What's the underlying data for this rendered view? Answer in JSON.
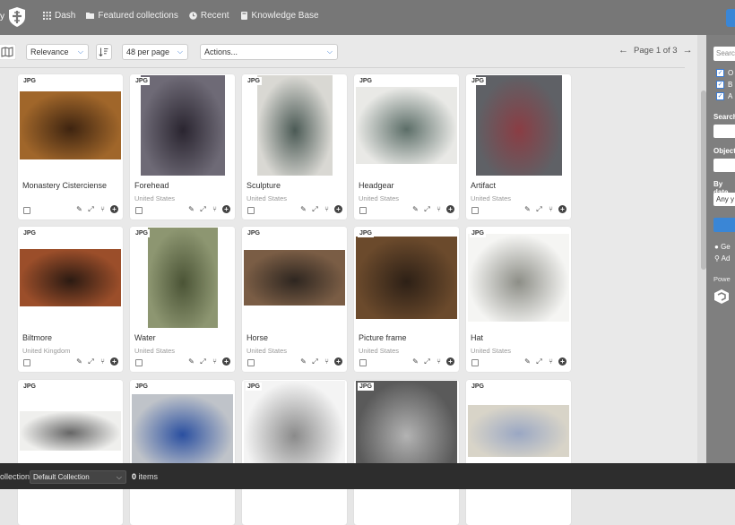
{
  "topbar": {
    "stub_text": "y",
    "nav": [
      {
        "icon": "dashboard-grid-icon",
        "label": "Dash"
      },
      {
        "icon": "folder-icon",
        "label": "Featured collections"
      },
      {
        "icon": "clock-icon",
        "label": "Recent"
      },
      {
        "icon": "book-icon",
        "label": "Knowledge Base"
      }
    ]
  },
  "toolbar": {
    "sort_value": "Relevance",
    "per_page_value": "48 per page",
    "actions_value": "Actions...",
    "pager_text": "Page 1 of 3"
  },
  "cards": [
    {
      "badge": "JPG",
      "title": "Monastery Cisterciense",
      "subtitle": "",
      "thumb_color": "#a0662a",
      "thumb_dark": "#3e2410"
    },
    {
      "badge": "JPG",
      "title": "Forehead",
      "subtitle": "United States",
      "thumb_color": "#6e6a76",
      "thumb_dark": "#2a2530"
    },
    {
      "badge": "JPG",
      "title": "Sculpture",
      "subtitle": "United States",
      "thumb_color": "#d9d8d3",
      "thumb_dark": "#4b5a55"
    },
    {
      "badge": "JPG",
      "title": "Headgear",
      "subtitle": "United States",
      "thumb_color": "#e9e9e6",
      "thumb_dark": "#5c6e68"
    },
    {
      "badge": "JPG",
      "title": "Artifact",
      "subtitle": "United States",
      "thumb_color": "#5f6166",
      "thumb_dark": "#8a3d44"
    },
    {
      "badge": "JPG",
      "title": "Biltmore",
      "subtitle": "United Kingdom",
      "thumb_color": "#9b4e2a",
      "thumb_dark": "#2b1a12"
    },
    {
      "badge": "JPG",
      "title": "Water",
      "subtitle": "United States",
      "thumb_color": "#8d9671",
      "thumb_dark": "#4b5436"
    },
    {
      "badge": "JPG",
      "title": "Horse",
      "subtitle": "United States",
      "thumb_color": "#7a5d45",
      "thumb_dark": "#2e2620"
    },
    {
      "badge": "JPG",
      "title": "Picture frame",
      "subtitle": "United States",
      "thumb_color": "#6b4a2c",
      "thumb_dark": "#2d2016"
    },
    {
      "badge": "JPG",
      "title": "Hat",
      "subtitle": "United States",
      "thumb_color": "#f5f5f3",
      "thumb_dark": "#8d8e87"
    },
    {
      "badge": "JPG",
      "title": "",
      "subtitle": "",
      "thumb_color": "#efefed",
      "thumb_dark": "#666"
    },
    {
      "badge": "JPG",
      "title": "",
      "subtitle": "",
      "thumb_color": "#bfc3c9",
      "thumb_dark": "#2a4fa0"
    },
    {
      "badge": "JPG",
      "title": "",
      "subtitle": "",
      "thumb_color": "#f4f4f4",
      "thumb_dark": "#8a8a8a"
    },
    {
      "badge": "JPG",
      "title": "",
      "subtitle": "",
      "thumb_color": "#5a5a5a",
      "thumb_dark": "#b3b3b3"
    },
    {
      "badge": "JPG",
      "title": "",
      "subtitle": "",
      "thumb_color": "#d8d4c8",
      "thumb_dark": "#9aa7c3"
    }
  ],
  "sidebar": {
    "search_placeholder": "Search",
    "checkboxes": [
      "O",
      "B",
      "A"
    ],
    "search_label": "Search",
    "object_label": "Object",
    "date_label": "By date",
    "date_value": "Any y",
    "link_1": "Ge",
    "link_2": "Ad",
    "powered": "Powe"
  },
  "footer": {
    "collection_label": "ollection:",
    "collection_value": "Default Collection",
    "count_num": "0",
    "count_text": " items"
  }
}
